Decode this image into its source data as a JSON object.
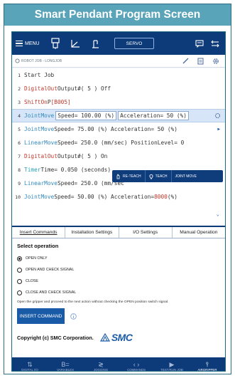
{
  "caption": "Smart Pendant Program Screen",
  "topbar": {
    "menu_label": "MENU",
    "servo_label": "SERVO"
  },
  "path": "ROBOT JOB - LONGJOB",
  "program": {
    "lines": [
      {
        "num": "1",
        "parts": [
          "Start Job"
        ]
      },
      {
        "num": "2",
        "parts": [
          "DigitalOut",
          " Output#( 5 )  Off"
        ]
      },
      {
        "num": "3",
        "parts": [
          "ShiftOn",
          " P",
          "[B005]"
        ]
      },
      {
        "num": "4",
        "parts": [
          "JointMove",
          "Speed= 100.00 (%)",
          "Acceleration= 50 (%)"
        ]
      },
      {
        "num": "5",
        "parts": [
          "JointMove",
          " Speed= 75.00 (%)  Acceleration= 50 (%)"
        ]
      },
      {
        "num": "6",
        "parts": [
          "LinearMove",
          " Speed= 250.0 (mm/sec)  PositionLevel= 0"
        ]
      },
      {
        "num": "7",
        "parts": [
          "DigitalOut",
          " Output#( 5 )  On"
        ]
      },
      {
        "num": "8",
        "parts": [
          "Timer",
          " Time= 0.050 (seconds)"
        ]
      },
      {
        "num": "9",
        "parts": [
          "LinearMove",
          " Speed= 250.0 (mm/sec"
        ]
      },
      {
        "num": "10",
        "parts": [
          "JointMove",
          " Speed= 50.00 (%)  Acceleration= ",
          "8000",
          "(%)"
        ]
      }
    ]
  },
  "teach": {
    "reteach": "RE-TEACH",
    "teach": "TEACH",
    "jointmove": "JOINT MOVE"
  },
  "tabs": [
    "Insert Commands",
    "Installation Settings",
    "I/O Settings",
    "Manual Operation"
  ],
  "panel": {
    "title": "Select operation",
    "options": [
      "OPEN ONLY",
      "OPEN AND CHECK SIGNAL",
      "CLOSE",
      "CLOSE AND CHECK SIGNAL"
    ],
    "description": "Open the gripper and proceed to the next action without checking the OPEN position switch signal.",
    "insert_label": "INSERT COMMAND",
    "copyright": "Copyright (c) SMC Corporation.",
    "brand": "SMC"
  },
  "nav": [
    {
      "icon": "⇅",
      "label": "DIGITAL I/O"
    },
    {
      "icon": "B=",
      "label": "VARIABLES"
    },
    {
      "icon": "≷",
      "label": "JOGGING"
    },
    {
      "icon": "‹ ›",
      "label": "COMMANDS"
    },
    {
      "icon": "▶",
      "label": "TEST/RUN JOB"
    },
    {
      "icon": "⫯",
      "label": "AIRGRIPPER"
    }
  ],
  "colors": {
    "header": "#59a4b8",
    "navy": "#0d3a78",
    "accent": "#1a5ba8"
  }
}
